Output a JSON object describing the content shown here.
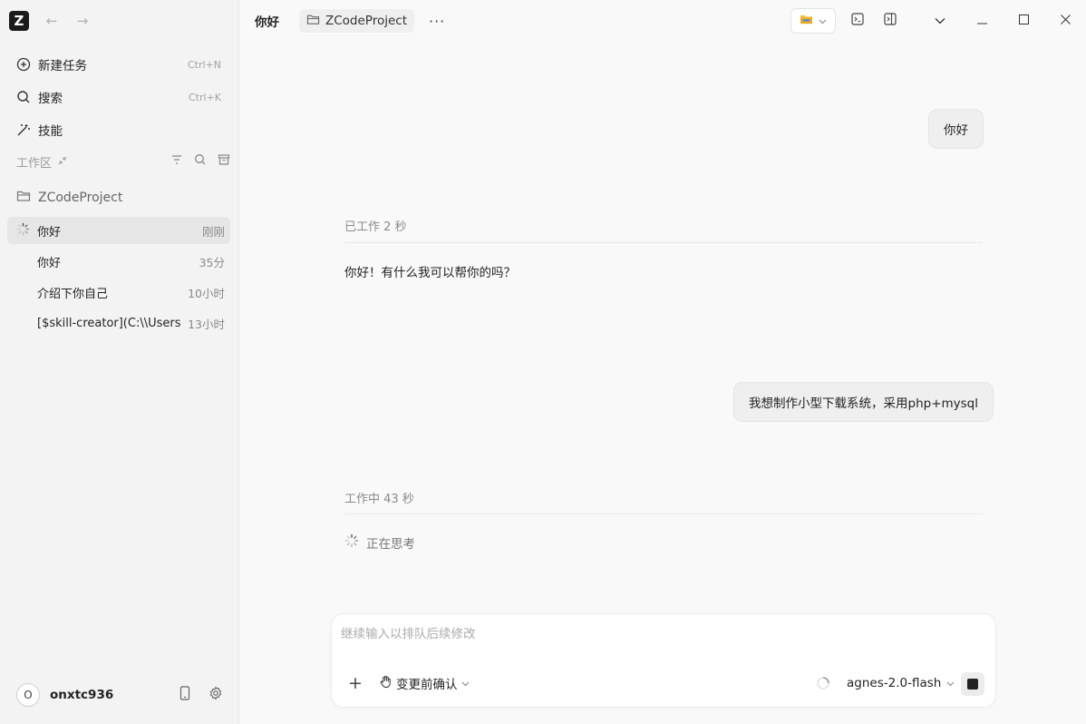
{
  "app": {
    "logo_letter": "Z"
  },
  "nav": {
    "back": "←",
    "forward": "→"
  },
  "sidebar": {
    "menu": [
      {
        "label": "新建任务",
        "shortcut": "Ctrl+N"
      },
      {
        "label": "搜索",
        "shortcut": "Ctrl+K"
      },
      {
        "label": "技能",
        "shortcut": ""
      }
    ],
    "workspace_label": "工作区",
    "project": "ZCodeProject",
    "threads": [
      {
        "label": "你好",
        "time": "刚刚"
      },
      {
        "label": "你好",
        "time": "35分"
      },
      {
        "label": "介绍下你自己",
        "time": "10小时"
      },
      {
        "label": "[$skill-creator](C:\\\\Users\\",
        "time": "13小时"
      }
    ],
    "user": {
      "initial": "O",
      "name": "onxtc936"
    }
  },
  "header": {
    "title": "你好",
    "project_chip": "ZCodeProject",
    "more": "···"
  },
  "conversation": {
    "user_msg_1": "你好",
    "worked_1": "已工作 2 秒",
    "reply_1": "你好！有什么我可以帮你的吗？",
    "user_msg_2": "我想制作小型下载系统，采用php+mysql",
    "worked_2": "工作中 43 秒",
    "thinking": "正在思考"
  },
  "composer": {
    "placeholder": "继续输入以排队后续修改",
    "plus": "+",
    "mode_label": "变更前确认",
    "model": "agnes-2.0-flash"
  },
  "colors": {
    "sidebar_bg": "#f3f3f3",
    "main_bg": "#f9f9f9",
    "bubble_bg": "#efefef",
    "active_thread_bg": "#e6e6e6"
  }
}
